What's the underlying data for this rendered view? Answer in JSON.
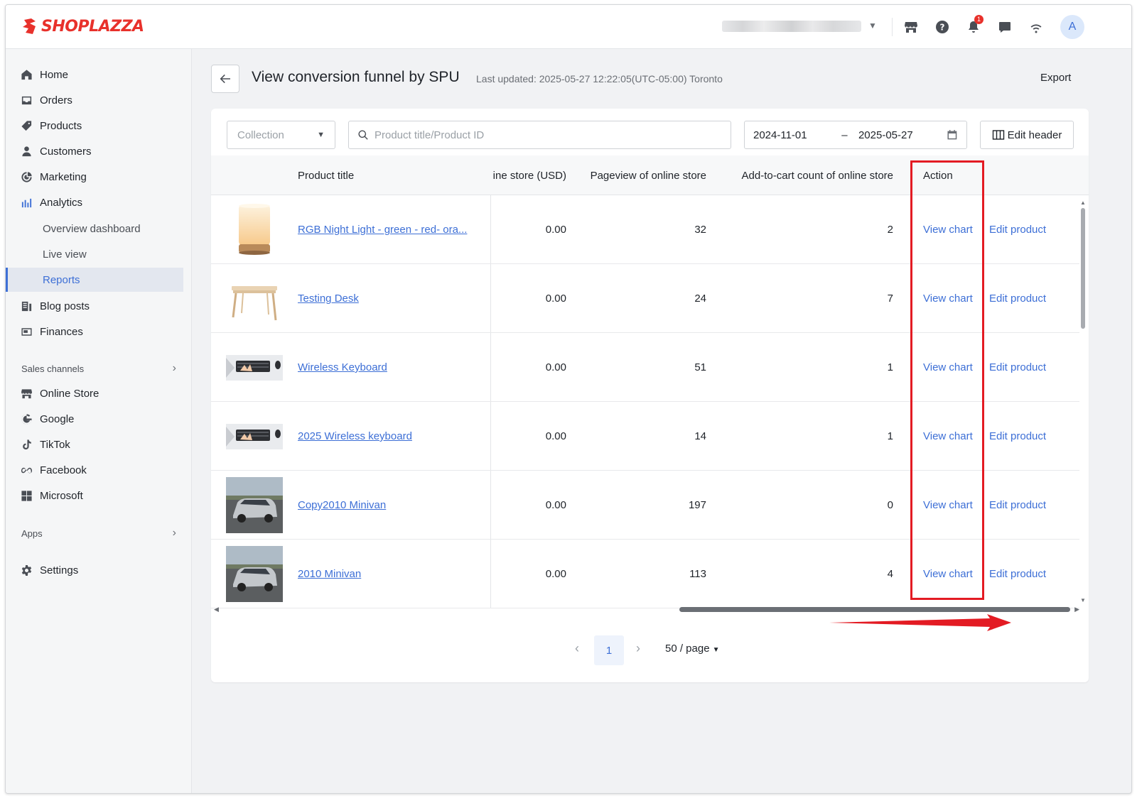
{
  "brand": {
    "name": "SHOPLAZZA",
    "color": "#e8312b"
  },
  "topbar": {
    "notification_count": "1",
    "avatar_letter": "A",
    "icons": [
      "storefront-icon",
      "help-icon",
      "bell-icon",
      "chat-icon",
      "wifi-icon"
    ]
  },
  "sidebar": {
    "items": [
      {
        "label": "Home",
        "icon": "home-icon"
      },
      {
        "label": "Orders",
        "icon": "orders-icon"
      },
      {
        "label": "Products",
        "icon": "tag-icon"
      },
      {
        "label": "Customers",
        "icon": "person-icon"
      },
      {
        "label": "Marketing",
        "icon": "marketing-icon"
      },
      {
        "label": "Analytics",
        "icon": "bar-chart-icon"
      }
    ],
    "analytics_sub": [
      {
        "label": "Overview dashboard"
      },
      {
        "label": "Live view"
      },
      {
        "label": "Reports"
      }
    ],
    "items2": [
      {
        "label": "Blog posts",
        "icon": "blog-icon"
      },
      {
        "label": "Finances",
        "icon": "finance-icon"
      }
    ],
    "sales_channels_label": "Sales channels",
    "channels": [
      {
        "label": "Online Store",
        "icon": "storefront-icon"
      },
      {
        "label": "Google",
        "icon": "google-icon"
      },
      {
        "label": "TikTok",
        "icon": "tiktok-icon"
      },
      {
        "label": "Facebook",
        "icon": "meta-icon"
      },
      {
        "label": "Microsoft",
        "icon": "microsoft-icon"
      }
    ],
    "apps_label": "Apps",
    "settings_label": "Settings"
  },
  "page": {
    "title": "View conversion funnel by SPU",
    "last_updated": "Last updated: 2025-05-27 12:22:05(UTC-05:00) Toronto",
    "export_label": "Export"
  },
  "filters": {
    "collection_placeholder": "Collection",
    "search_placeholder": "Product title/Product ID",
    "date_start": "2024-11-01",
    "date_separator": "–",
    "date_end": "2025-05-27",
    "edit_header_label": "Edit header"
  },
  "table": {
    "headers": {
      "product_title": "Product title",
      "sales": "ine store (USD)",
      "pageview": "Pageview of online store",
      "add_to_cart": "Add-to-cart count of online store",
      "action": "Action"
    },
    "view_chart_label": "View chart",
    "edit_product_label": "Edit product",
    "rows": [
      {
        "title": "RGB Night Light - green - red- ora...",
        "sales": "0.00",
        "pageview": "32",
        "add_to_cart": "2",
        "thumb": "lamp"
      },
      {
        "title": "Testing Desk",
        "sales": "0.00",
        "pageview": "24",
        "add_to_cart": "7",
        "thumb": "desk"
      },
      {
        "title": "Wireless Keyboard",
        "sales": "0.00",
        "pageview": "51",
        "add_to_cart": "1",
        "thumb": "keyboard"
      },
      {
        "title": "2025 Wireless keyboard",
        "sales": "0.00",
        "pageview": "14",
        "add_to_cart": "1",
        "thumb": "keyboard"
      },
      {
        "title": "Copy2010 Minivan",
        "sales": "0.00",
        "pageview": "197",
        "add_to_cart": "0",
        "thumb": "minivan"
      },
      {
        "title": "2010 Minivan",
        "sales": "0.00",
        "pageview": "113",
        "add_to_cart": "4",
        "thumb": "minivan"
      }
    ]
  },
  "pagination": {
    "current_page": "1",
    "page_size": "50 / page"
  },
  "colors": {
    "accent": "#3d6fd6",
    "highlight": "#e31b23"
  }
}
